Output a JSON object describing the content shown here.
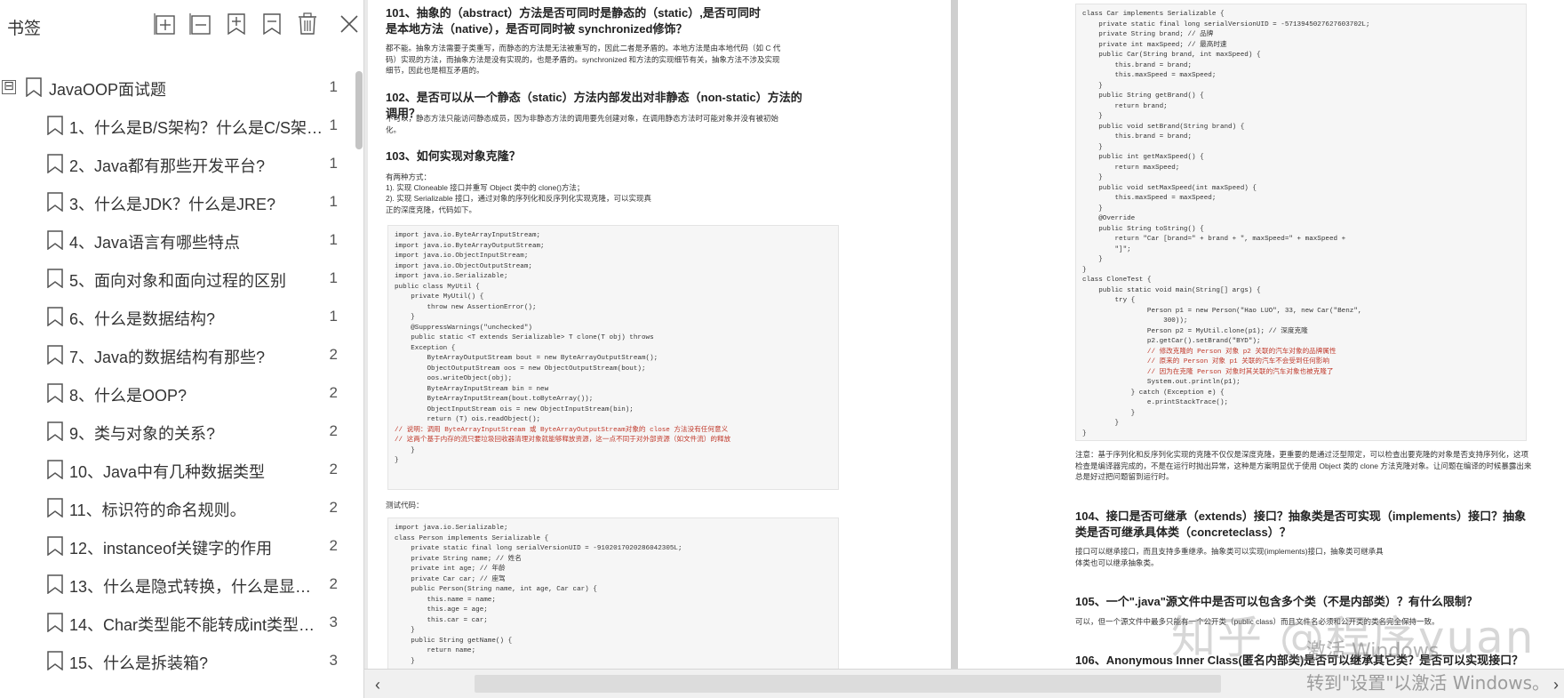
{
  "sidebar": {
    "title": "书签",
    "toolbar_icons": [
      "expand-all-icon",
      "collapse-all-icon",
      "add-bookmark-icon",
      "remove-bookmark-icon",
      "delete-icon",
      "close-icon"
    ],
    "root": {
      "label": "JavaOOP面试题",
      "page": "1",
      "expander": "⊟"
    },
    "items": [
      {
        "label": "1、什么是B/S架构？什么是C/S架…",
        "page": "1"
      },
      {
        "label": "2、Java都有那些开发平台?",
        "page": "1"
      },
      {
        "label": "3、什么是JDK？什么是JRE?",
        "page": "1"
      },
      {
        "label": "4、Java语言有哪些特点",
        "page": "1"
      },
      {
        "label": "5、面向对象和面向过程的区别",
        "page": "1"
      },
      {
        "label": "6、什么是数据结构?",
        "page": "1"
      },
      {
        "label": "7、Java的数据结构有那些?",
        "page": "2"
      },
      {
        "label": "8、什么是OOP?",
        "page": "2"
      },
      {
        "label": "9、类与对象的关系?",
        "page": "2"
      },
      {
        "label": "10、Java中有几种数据类型",
        "page": "2"
      },
      {
        "label": "11、标识符的命名规则。",
        "page": "2"
      },
      {
        "label": "12、instanceof关键字的作用",
        "page": "2"
      },
      {
        "label": "13、什么是隐式转换，什么是显…",
        "page": "2"
      },
      {
        "label": "14、Char类型能不能转成int类型…",
        "page": "3"
      },
      {
        "label": "15、什么是拆装箱?",
        "page": "3"
      }
    ]
  },
  "left_page": {
    "q101_title": "101、抽象的（abstract）方法是否可同时是静态的（static）,是否可同时是本地方法（native），是否可同时被 synchronized修饰？",
    "q101_body": "都不能。抽象方法需要子类重写，而静态的方法是无法被重写的，因此二者是矛盾的。本地方法是由本地代码（如 C 代码）实现的方法，而抽象方法是没有实现的，也是矛盾的。synchronized 和方法的实现细节有关，抽象方法不涉及实现细节，因此也是相互矛盾的。",
    "q102_title": "102、是否可以从一个静态（static）方法内部发出对非静态（non-static）方法的调用？",
    "q102_body": "不可以，静态方法只能访问静态成员，因为非静态方法的调用要先创建对象，在调用静态方法时可能对象并没有被初始化。",
    "q103_title": "103、如何实现对象克隆？",
    "q103_intro": "有两种方式：",
    "q103_way1": "1). 实现 Cloneable 接口并重写 Object 类中的 clone()方法；",
    "q103_way2": "2). 实现 Serializable 接口，通过对象的序列化和反序列化实现克隆，可以实现真正的深度克隆，代码如下。",
    "code1": [
      "import java.io.ByteArrayInputStream;",
      "import java.io.ByteArrayOutputStream;",
      "import java.io.ObjectInputStream;",
      "import java.io.ObjectOutputStream;",
      "import java.io.Serializable;",
      "public class MyUtil {",
      "    private MyUtil() {",
      "        throw new AssertionError();",
      "    }",
      "    @SuppressWarnings(\"unchecked\")",
      "    public static <T extends Serializable> T clone(T obj) throws",
      "    Exception {",
      "        ByteArrayOutputStream bout = new ByteArrayOutputStream();",
      "        ObjectOutputStream oos = new ObjectOutputStream(bout);",
      "        oos.writeObject(obj);",
      "        ByteArrayInputStream bin = new",
      "        ByteArrayInputStream(bout.toByteArray());",
      "        ObjectInputStream ois = new ObjectInputStream(bin);",
      "        return (T) ois.readObject();",
      "// 说明：调用 ByteArrayInputStream 或 ByteArrayOutputStream对象的 close 方法没有任何意义",
      "// 这两个基于内存的流只要垃圾回收器清理对象就能够释放资源，这一点不同于对外部资源（如文件流）的释放",
      "    }",
      "}"
    ],
    "test_label": "测试代码：",
    "code2": [
      "import java.io.Serializable;",
      "class Person implements Serializable {",
      "    private static final long serialVersionUID = -9102017020286042305L;",
      "    private String name; // 姓名",
      "    private int age; // 年龄",
      "    private Car car; // 座驾",
      "    public Person(String name, int age, Car car) {",
      "        this.name = name;",
      "        this.age = age;",
      "        this.car = car;",
      "    }",
      "    public String getName() {",
      "        return name;",
      "    }"
    ]
  },
  "right_page": {
    "code3": [
      "class Car implements Serializable {",
      "    private static final long serialVersionUID = -5713945027627603702L;",
      "    private String brand; // 品牌",
      "    private int maxSpeed; // 最高时速",
      "    public Car(String brand, int maxSpeed) {",
      "        this.brand = brand;",
      "        this.maxSpeed = maxSpeed;",
      "    }",
      "    public String getBrand() {",
      "        return brand;",
      "    }",
      "    public void setBrand(String brand) {",
      "        this.brand = brand;",
      "    }",
      "    public int getMaxSpeed() {",
      "        return maxSpeed;",
      "    }",
      "    public void setMaxSpeed(int maxSpeed) {",
      "        this.maxSpeed = maxSpeed;",
      "    }",
      "    @Override",
      "    public String toString() {",
      "        return \"Car [brand=\" + brand + \", maxSpeed=\" + maxSpeed +",
      "        \"]\";",
      "    }",
      "}",
      "class CloneTest {",
      "    public static void main(String[] args) {",
      "        try {",
      "                Person p1 = new Person(\"Hao LUO\", 33, new Car(\"Benz\",",
      "                    300));",
      "                Person p2 = MyUtil.clone(p1); // 深度克隆",
      "                p2.getCar().setBrand(\"BYD\");",
      "                // 修改克隆的 Person 对象 p2 关联的汽车对象的品牌属性",
      "                // 原来的 Person 对象 p1 关联的汽车不会受到任何影响",
      "                // 因为在克隆 Person 对象时其关联的汽车对象也被克隆了",
      "                System.out.println(p1);",
      "            } catch (Exception e) {",
      "                e.printStackTrace();",
      "            }",
      "        }",
      "}"
    ],
    "note": "注意：基于序列化和反序列化实现的克隆不仅仅是深度克隆，更重要的是通过泛型限定，可以检查出要克隆的对象是否支持序列化，这项检查是编译器完成的，不是在运行时抛出异常，这种是方案明显优于使用 Object 类的 clone 方法克隆对象。让问题在编译的时候暴露出来总是好过把问题留到运行时。",
    "q104_title": "104、接口是否可继承（extends）接口？抽象类是否可实现（implements）接口？抽象类是否可继承具体类（concreteclass）？",
    "q104_body": "接口可以继承接口，而且支持多重继承。抽象类可以实现(implements)接口，抽象类可继承具体类也可以继承抽象类。",
    "q105_title": "105、一个\".java\"源文件中是否可以包含多个类（不是内部类）？有什么限制？",
    "q105_body": "可以，但一个源文件中最多只能有一个公开类（public class）而且文件名必须和公开类的类名完全保持一致。",
    "q106_title": "106、Anonymous Inner Class(匿名内部类)是否可以继承其它类？是否可以实现接口？"
  },
  "watermark": "知乎 @程序yuan",
  "activation": {
    "line1": "激活 Windows",
    "line2": "转到\"设置\"以激活 Windows。"
  },
  "scrollbar": {
    "left_arrow": "‹",
    "right_arrow": "›"
  }
}
